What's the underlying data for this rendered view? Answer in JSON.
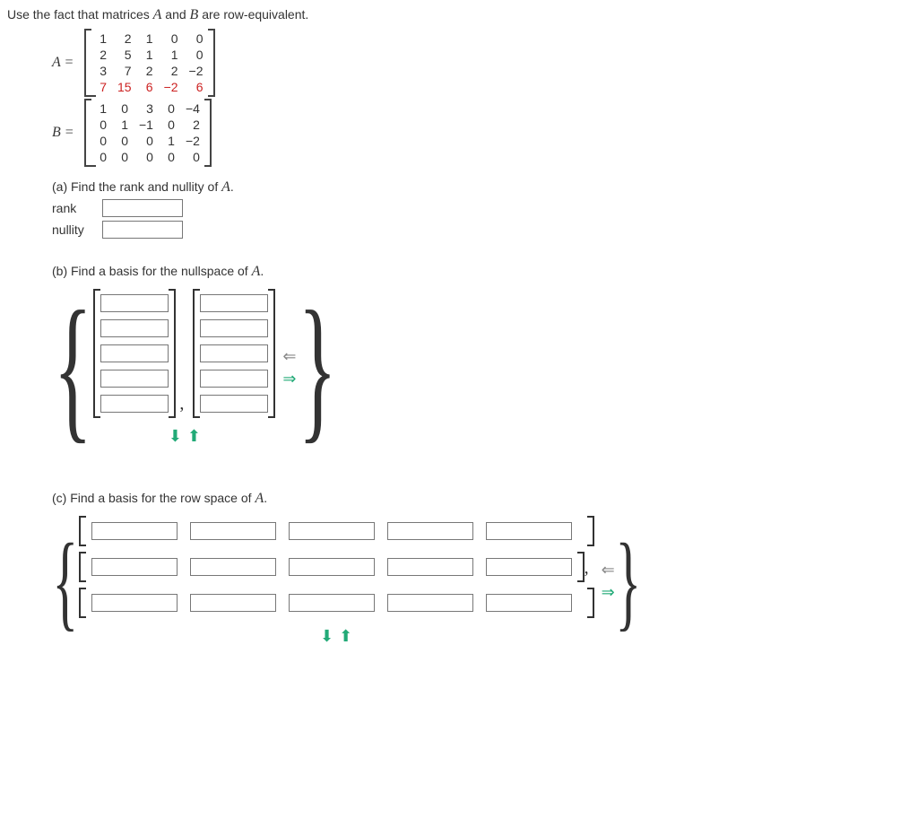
{
  "intro": {
    "pre": "Use the fact that matrices ",
    "a": "A",
    "mid": " and ",
    "b": "B",
    "post": " are row-equivalent."
  },
  "mat_a_label": "A =",
  "mat_b_label": "B =",
  "matrix_a": [
    [
      "1",
      "2",
      "1",
      "0",
      "0"
    ],
    [
      "2",
      "5",
      "1",
      "1",
      "0"
    ],
    [
      "3",
      "7",
      "2",
      "2",
      "−2"
    ],
    [
      "7",
      "15",
      "6",
      "−2",
      "6"
    ]
  ],
  "matrix_b": [
    [
      "1",
      "0",
      "3",
      "0",
      "−4"
    ],
    [
      "0",
      "1",
      "−1",
      "0",
      "2"
    ],
    [
      "0",
      "0",
      "0",
      "1",
      "−2"
    ],
    [
      "0",
      "0",
      "0",
      "0",
      "0"
    ]
  ],
  "part_a": {
    "prompt_pre": "(a) Find the rank and nullity of ",
    "prompt_var": "A",
    "prompt_post": ".",
    "rank_label": "rank",
    "nullity_label": "nullity",
    "rank_value": "",
    "nullity_value": ""
  },
  "part_b": {
    "prompt_pre": "(b) Find a basis for the nullspace of ",
    "prompt_var": "A",
    "prompt_post": ".",
    "vectors": [
      [
        "",
        "",
        "",
        "",
        ""
      ],
      [
        "",
        "",
        "",
        "",
        ""
      ]
    ]
  },
  "part_c": {
    "prompt_pre": "(c) Find a basis for the row space of ",
    "prompt_var": "A",
    "prompt_post": ".",
    "vectors": [
      [
        "",
        "",
        "",
        "",
        ""
      ],
      [
        "",
        "",
        "",
        "",
        ""
      ],
      [
        "",
        "",
        "",
        "",
        ""
      ]
    ]
  },
  "icons": {
    "arrow_left": "⇐",
    "arrow_right": "⇒",
    "arrow_down": "⬇",
    "arrow_up": "⬆"
  }
}
